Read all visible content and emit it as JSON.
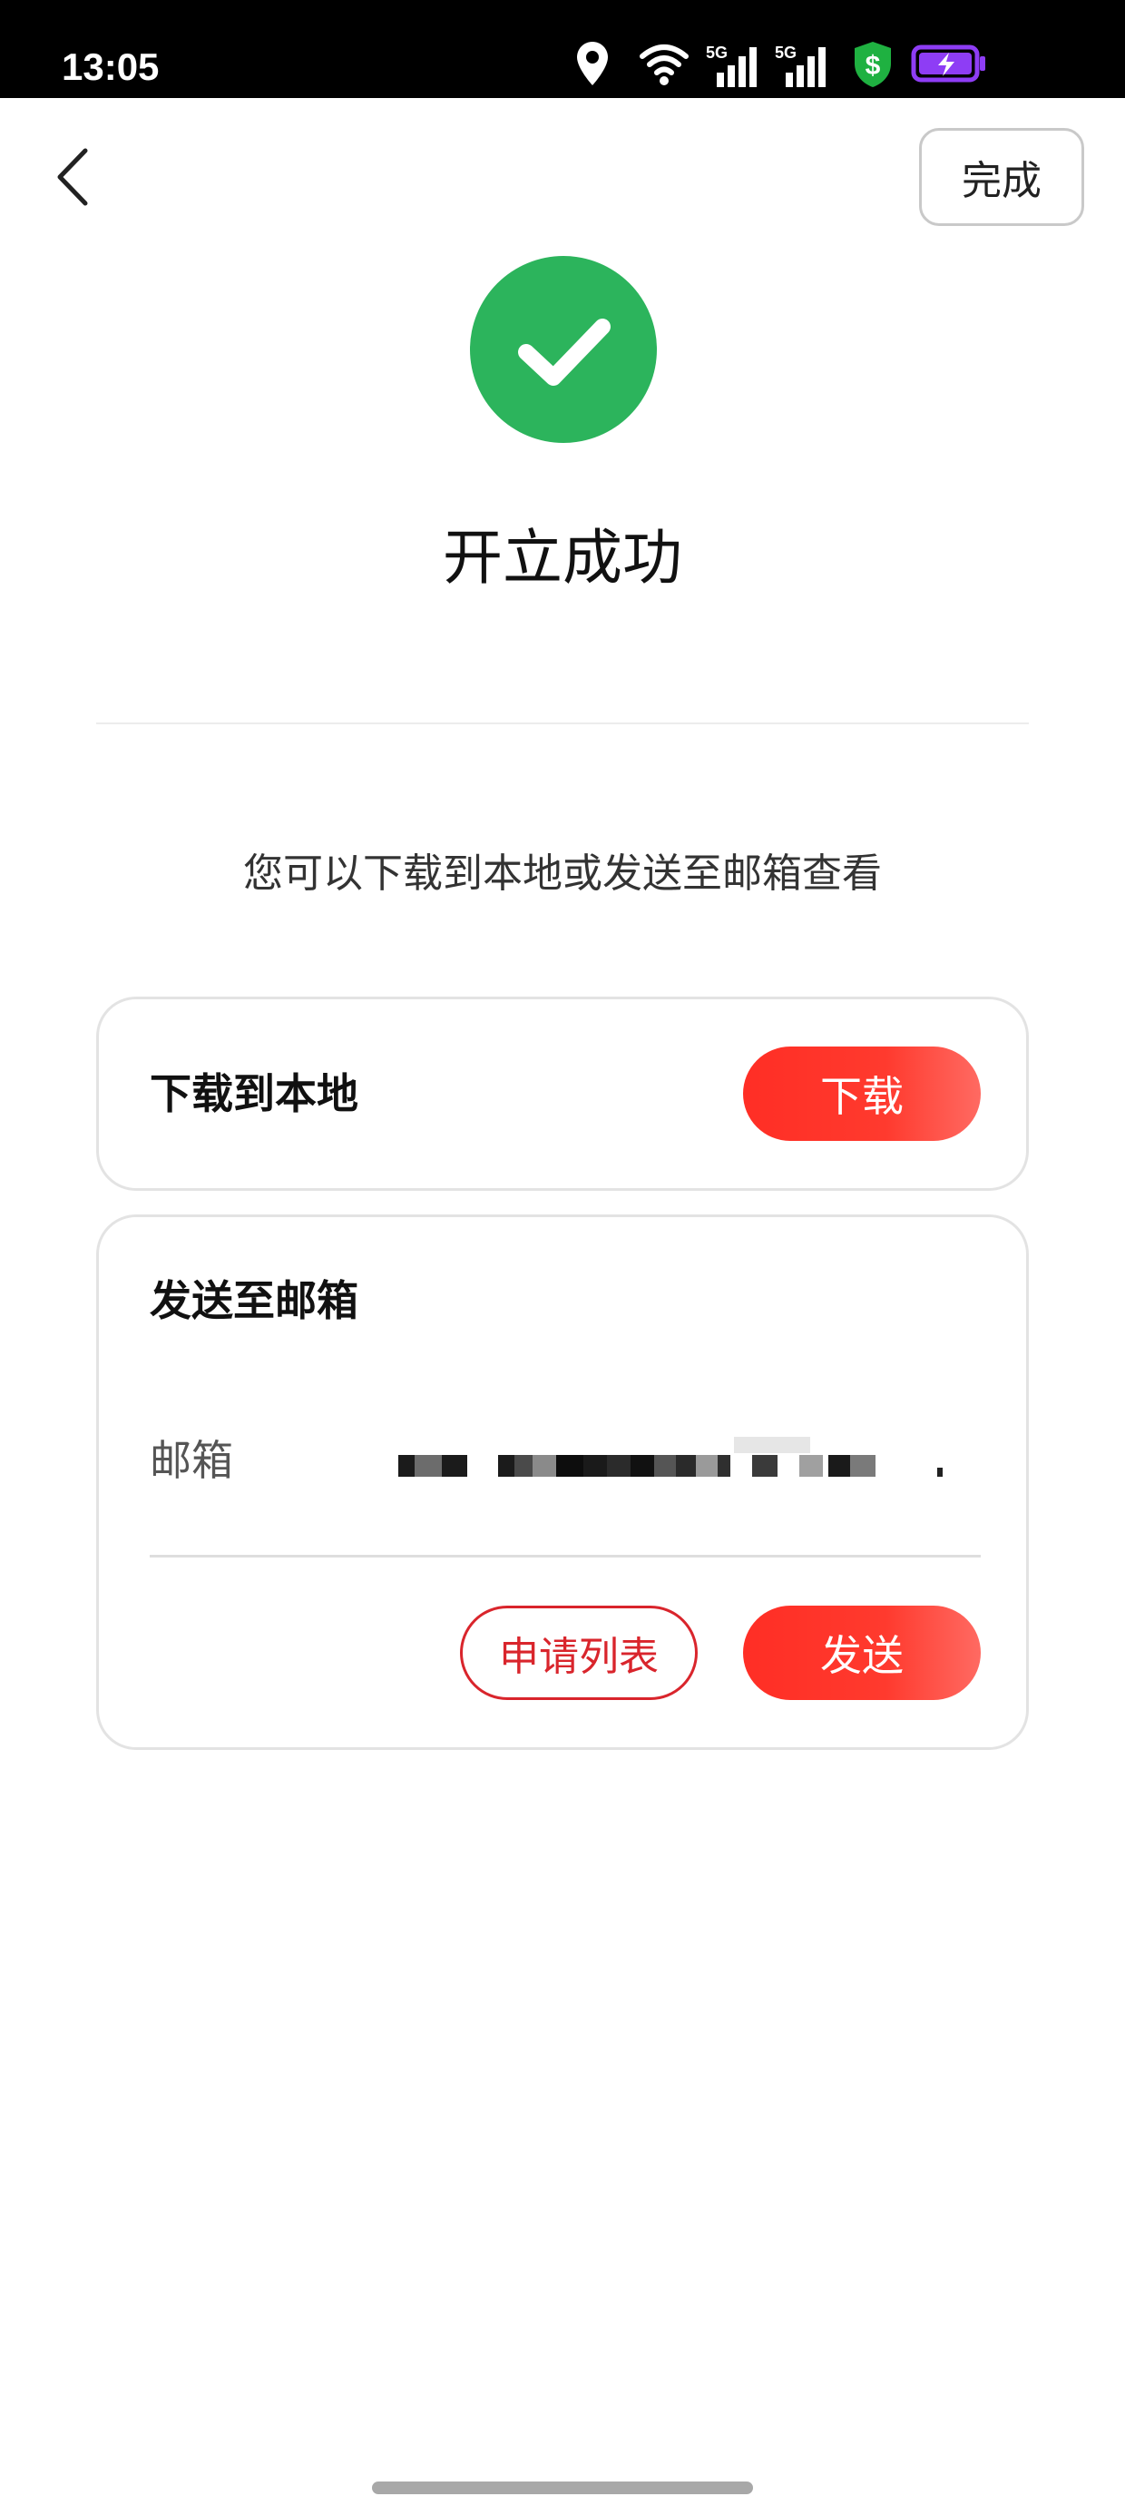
{
  "status_bar": {
    "time": "13:05",
    "icons": [
      "location-icon",
      "wifi-icon",
      "signal-5g-icon",
      "signal-5g-icon",
      "shield-dollar-icon",
      "battery-charging-icon"
    ],
    "network_label": "5G",
    "colors": {
      "shield": "#1fb141",
      "battery": "#8e3df5"
    }
  },
  "nav": {
    "back_icon": "chevron-left-icon",
    "done_label": "完成"
  },
  "success": {
    "icon": "check-circle-icon",
    "icon_color": "#2cb45c",
    "title": "开立成功"
  },
  "instruction": "您可以下载到本地或发送至邮箱查看",
  "download_card": {
    "title": "下载到本地",
    "button_label": "下载"
  },
  "email_card": {
    "title": "发送至邮箱",
    "field_label": "邮箱",
    "field_value_masked": true,
    "apply_list_label": "申请列表",
    "send_label": "发送"
  },
  "theme": {
    "primary_red": "#ff3a2e",
    "outline_red": "#d9252c"
  }
}
